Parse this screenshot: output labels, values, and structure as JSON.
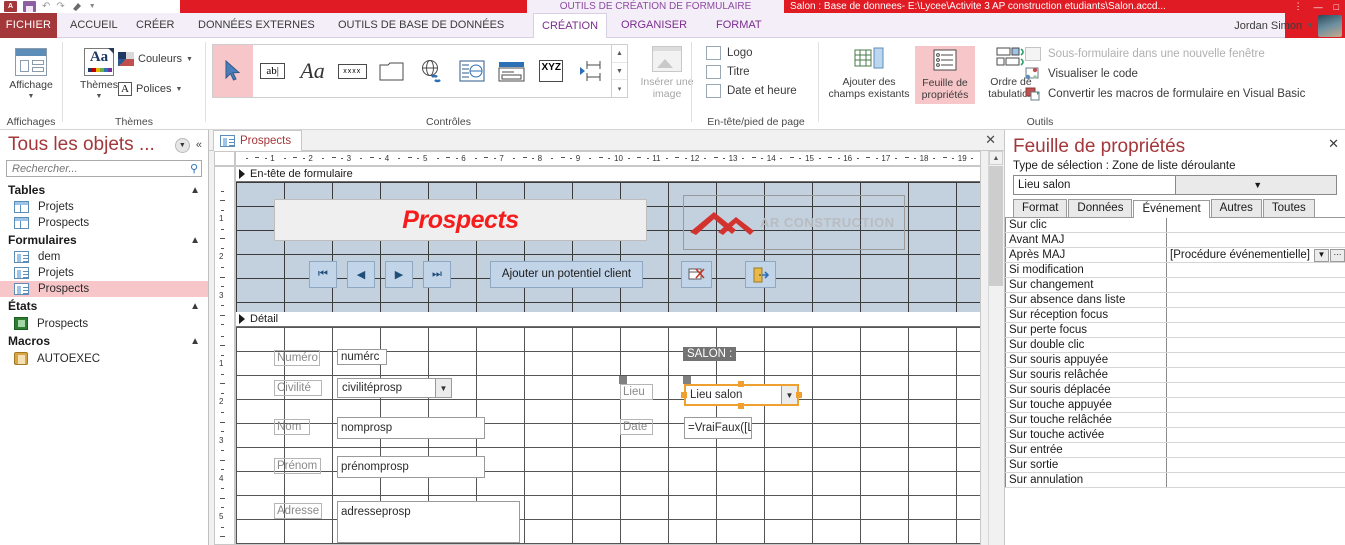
{
  "titlebar": {
    "qat": [
      "access-logo-icon",
      "save-icon",
      "undo-icon",
      "redo-icon",
      "paint-icon",
      "customize-qat-icon"
    ],
    "contextual_title": "OUTILS DE CRÉATION DE FORMULAIRE",
    "document_title": "Salon : Base de donnees- E:\\Lycee\\Activite 3 AP construction etudiants\\Salon.accd...",
    "window_controls": [
      "minimize",
      "restore",
      "close"
    ],
    "user_name": "Jordan Simon"
  },
  "ribbon": {
    "file_tab": "FICHIER",
    "tabs": [
      {
        "label": "ACCUEIL",
        "active": false,
        "contextual": false
      },
      {
        "label": "CRÉER",
        "active": false,
        "contextual": false
      },
      {
        "label": "DONNÉES EXTERNES",
        "active": false,
        "contextual": false
      },
      {
        "label": "OUTILS DE BASE DE DONNÉES",
        "active": false,
        "contextual": false
      },
      {
        "label": "CRÉATION",
        "active": true,
        "contextual": true
      },
      {
        "label": "ORGANISER",
        "active": false,
        "contextual": true
      },
      {
        "label": "FORMAT",
        "active": false,
        "contextual": true
      }
    ],
    "groups": {
      "affichages": {
        "label": "Affichages",
        "button": "Affichage"
      },
      "themes": {
        "label": "Thèmes",
        "button": "Thèmes",
        "couleurs": "Couleurs",
        "polices": "Polices"
      },
      "controles": {
        "label": "Contrôles",
        "items": [
          "select-pointer-icon",
          "text-box-icon",
          "label-icon",
          "button-icon",
          "tab-control-icon",
          "hyperlink-icon",
          "web-browser-icon",
          "navigation-icon",
          "option-group-icon",
          "page-break-icon"
        ],
        "insert_image": "Insérer une image"
      },
      "entete": {
        "label": "En-tête/pied de page",
        "items": [
          "Logo",
          "Titre",
          "Date et heure"
        ]
      },
      "outils_group": {
        "label": "Outils",
        "add_fields": "Ajouter des champs existants",
        "property_sheet": "Feuille de propriétés",
        "tab_order": "Ordre de tabulation",
        "items": [
          {
            "label": "Sous-formulaire dans une nouvelle fenêtre",
            "disabled": true
          },
          {
            "label": "Visualiser le code",
            "disabled": false
          },
          {
            "label": "Convertir les macros de formulaire en Visual Basic",
            "disabled": false
          }
        ]
      }
    }
  },
  "navpane": {
    "title": "Tous les objets ...",
    "search_placeholder": "Rechercher...",
    "groups": [
      {
        "name": "Tables",
        "items": [
          {
            "label": "Projets",
            "icon": "table-icon",
            "selected": false
          },
          {
            "label": "Prospects",
            "icon": "table-icon",
            "selected": false
          }
        ]
      },
      {
        "name": "Formulaires",
        "items": [
          {
            "label": "dem",
            "icon": "form-icon",
            "selected": false
          },
          {
            "label": "Projets",
            "icon": "form-icon",
            "selected": false
          },
          {
            "label": "Prospects",
            "icon": "form-icon",
            "selected": true
          }
        ]
      },
      {
        "name": "États",
        "items": [
          {
            "label": "Prospects",
            "icon": "report-icon",
            "selected": false
          }
        ]
      },
      {
        "name": "Macros",
        "items": [
          {
            "label": "AUTOEXEC",
            "icon": "macro-icon",
            "selected": false
          }
        ]
      }
    ]
  },
  "document": {
    "tab_label": "Prospects",
    "ruler_ticks": [
      "1",
      "2",
      "3",
      "4",
      "5",
      "6",
      "7",
      "8",
      "9",
      "10",
      "11",
      "12",
      "13",
      "14",
      "15",
      "16",
      "17",
      "18",
      "19"
    ],
    "vruler_header_ticks": [
      "1",
      "2",
      "3"
    ],
    "vruler_detail_ticks": [
      "1",
      "2",
      "3",
      "4",
      "5"
    ],
    "sections": {
      "header": "En-tête de formulaire",
      "detail": "Détail"
    },
    "header_controls": {
      "title_text": "Prospects",
      "logo_text": "AR CONSTRUCTION",
      "nav_buttons": [
        "first-record-icon",
        "previous-record-icon",
        "next-record-icon",
        "last-record-icon"
      ],
      "add_button": "Ajouter un potentiel client",
      "delete_button": "delete-record-icon",
      "exit_button": "exit-door-icon"
    },
    "detail_controls": [
      {
        "label": "Numéro",
        "value": "numérc",
        "type": "textbox"
      },
      {
        "label": "Civilité",
        "value": "civilitéprosp",
        "type": "combobox"
      },
      {
        "label": "Nom",
        "value": "nomprosp",
        "type": "textbox"
      },
      {
        "label": "Prénom",
        "value": "prénomprosp",
        "type": "textbox"
      },
      {
        "label": "Adresse",
        "value": "adresseprosp",
        "type": "textbox"
      }
    ],
    "salon_group": {
      "tag": "SALON :",
      "rows": [
        {
          "label": "Lieu",
          "value": "Lieu salon",
          "type": "combobox",
          "selected": true
        },
        {
          "label": "Date",
          "value": "=VraiFaux([Lie",
          "type": "textbox",
          "selected": false
        }
      ]
    }
  },
  "propertysheet": {
    "title": "Feuille de propriétés",
    "selection_type_label": "Type de sélection :",
    "selection_type_value": "Zone de liste déroulante",
    "selected_object": "Lieu salon",
    "tabs": [
      {
        "label": "Format",
        "active": false
      },
      {
        "label": "Données",
        "active": false
      },
      {
        "label": "Événement",
        "active": true
      },
      {
        "label": "Autres",
        "active": false
      },
      {
        "label": "Toutes",
        "active": false
      }
    ],
    "rows": [
      {
        "key": "Sur clic",
        "value": "",
        "has_buttons": false
      },
      {
        "key": "Avant MAJ",
        "value": "",
        "has_buttons": false
      },
      {
        "key": "Après MAJ",
        "value": "[Procédure événementielle]",
        "has_buttons": true
      },
      {
        "key": "Si modification",
        "value": "",
        "has_buttons": false
      },
      {
        "key": "Sur changement",
        "value": "",
        "has_buttons": false
      },
      {
        "key": "Sur absence dans liste",
        "value": "",
        "has_buttons": false
      },
      {
        "key": "Sur réception focus",
        "value": "",
        "has_buttons": false
      },
      {
        "key": "Sur perte focus",
        "value": "",
        "has_buttons": false
      },
      {
        "key": "Sur double clic",
        "value": "",
        "has_buttons": false
      },
      {
        "key": "Sur souris appuyée",
        "value": "",
        "has_buttons": false
      },
      {
        "key": "Sur souris relâchée",
        "value": "",
        "has_buttons": false
      },
      {
        "key": "Sur souris déplacée",
        "value": "",
        "has_buttons": false
      },
      {
        "key": "Sur touche appuyée",
        "value": "",
        "has_buttons": false
      },
      {
        "key": "Sur touche relâchée",
        "value": "",
        "has_buttons": false
      },
      {
        "key": "Sur touche activée",
        "value": "",
        "has_buttons": false
      },
      {
        "key": "Sur entrée",
        "value": "",
        "has_buttons": false
      },
      {
        "key": "Sur sortie",
        "value": "",
        "has_buttons": false
      },
      {
        "key": "Sur annulation",
        "value": "",
        "has_buttons": false
      }
    ]
  },
  "colors": {
    "accent_red": "#a4373a",
    "title_red": "#e01b24",
    "selection_pink": "#f7c6c9",
    "contextual_purple": "#7b2d8e",
    "form_header_blue": "#c3d0de",
    "selection_orange": "#f0a030"
  }
}
